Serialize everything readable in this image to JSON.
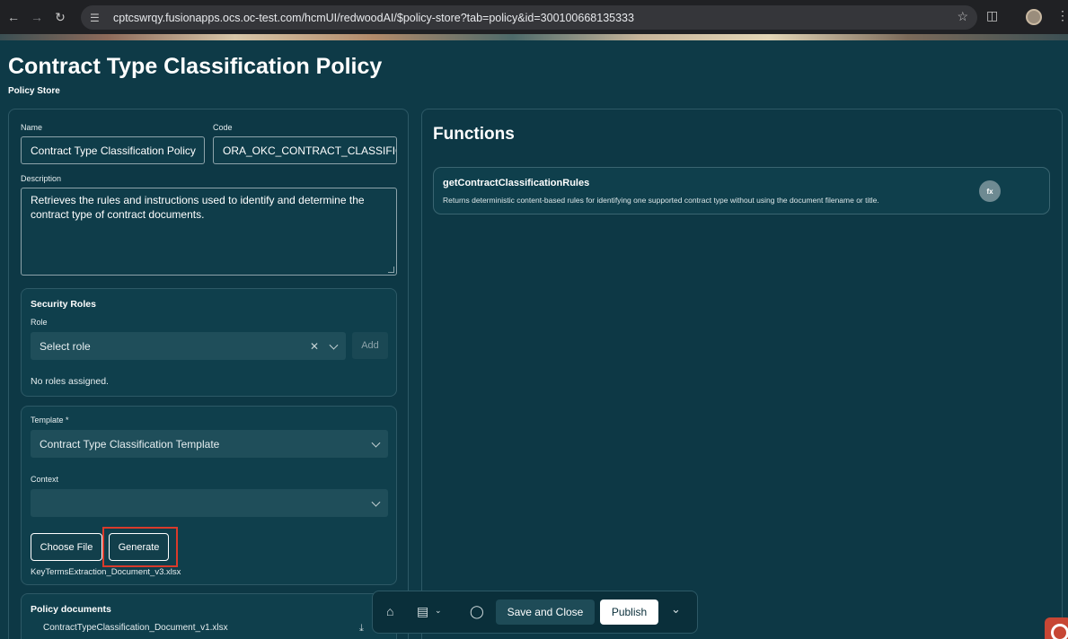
{
  "browser": {
    "url": "cptcswrqy.fusionapps.ocs.oc-test.com/hcmUI/redwoodAI/$policy-store?tab=policy&id=300100668135333"
  },
  "header": {
    "title": "Contract Type Classification Policy",
    "subtitle": "Policy Store"
  },
  "form": {
    "name_label": "Name",
    "name_value": "Contract Type Classification Policy",
    "code_label": "Code",
    "code_value": "ORA_OKC_CONTRACT_CLASSIFICAT",
    "description_label": "Description",
    "description_value": "Retrieves the rules and instructions used to identify and determine the contract type of contract documents."
  },
  "security": {
    "title": "Security Roles",
    "role_label": "Role",
    "role_placeholder": "Select role",
    "add_label": "Add",
    "empty_text": "No roles assigned."
  },
  "template": {
    "template_label": "Template *",
    "template_value": "Contract Type Classification Template",
    "context_label": "Context",
    "context_value": "",
    "choose_file_label": "Choose File",
    "generate_label": "Generate",
    "file_name": "KeyTermsExtraction_Document_v3.xlsx"
  },
  "policy_documents": {
    "title": "Policy documents",
    "items": [
      "ContractTypeClassification_Document_v1.xlsx"
    ]
  },
  "functions": {
    "title": "Functions",
    "items": [
      {
        "name": "getContractClassificationRules",
        "description": "Returns deterministic content-based rules for identifying one supported contract type without using the document filename or title.",
        "badge": "fx"
      }
    ]
  },
  "toolbar": {
    "save_close_label": "Save and Close",
    "publish_label": "Publish"
  },
  "icons": [
    "back-icon",
    "forward-icon",
    "reload-icon",
    "site-settings-icon",
    "bookmark-star-icon",
    "extensions-icon",
    "profile-avatar",
    "browser-menu-icon",
    "clear-icon",
    "chevron-down-icon",
    "download-icon",
    "home-icon",
    "print-icon",
    "feedback-icon",
    "expand-icon"
  ],
  "colors": {
    "background": "#0e3a47",
    "panel": "#0d3845",
    "highlight": "#d93a2b"
  }
}
